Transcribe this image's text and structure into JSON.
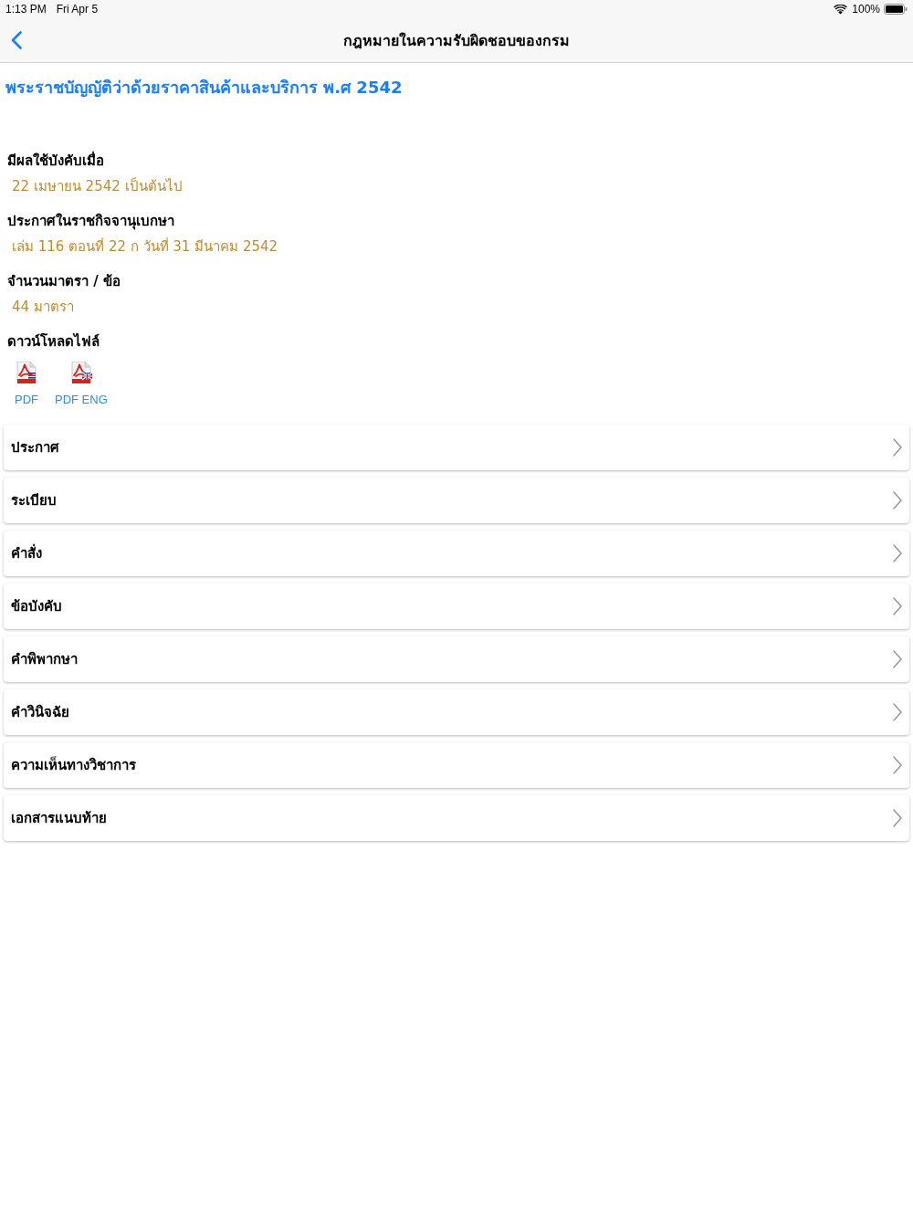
{
  "status_bar": {
    "time": "1:13 PM",
    "date": "Fri Apr 5",
    "battery": "100%"
  },
  "nav_bar": {
    "title": "กฎหมายในความรับผิดชอบของกรม"
  },
  "law_title": "พระราชบัญญัติว่าด้วยราคาสินค้าและบริการ พ.ศ 2542",
  "fields": [
    {
      "label": "มีผลใช้บังคับเมื่อ",
      "value": "22 เมษายน 2542 เป็นต้นไป"
    },
    {
      "label": "ประกาศในราชกิจจานุเบกษา",
      "value": "เล่ม 116 ตอนที่ 22 ก วันที่ 31 มีนาคม 2542"
    },
    {
      "label": "จำนวนมาตรา / ข้อ",
      "value": "44 มาตรา"
    }
  ],
  "downloads": {
    "label": "ดาวน์โหลดไฟล์",
    "files": [
      {
        "label": "PDF",
        "kind": "plain"
      },
      {
        "label": "PDF ENG",
        "kind": "english"
      }
    ]
  },
  "menu": [
    "ประกาศ",
    "ระเบียบ",
    "คำสั่ง",
    "ข้อบังคับ",
    "คำพิพากษา",
    "คำวินิจฉัย",
    "ความเห็นทางวิชาการ",
    "เอกสารแนบท้าย"
  ]
}
